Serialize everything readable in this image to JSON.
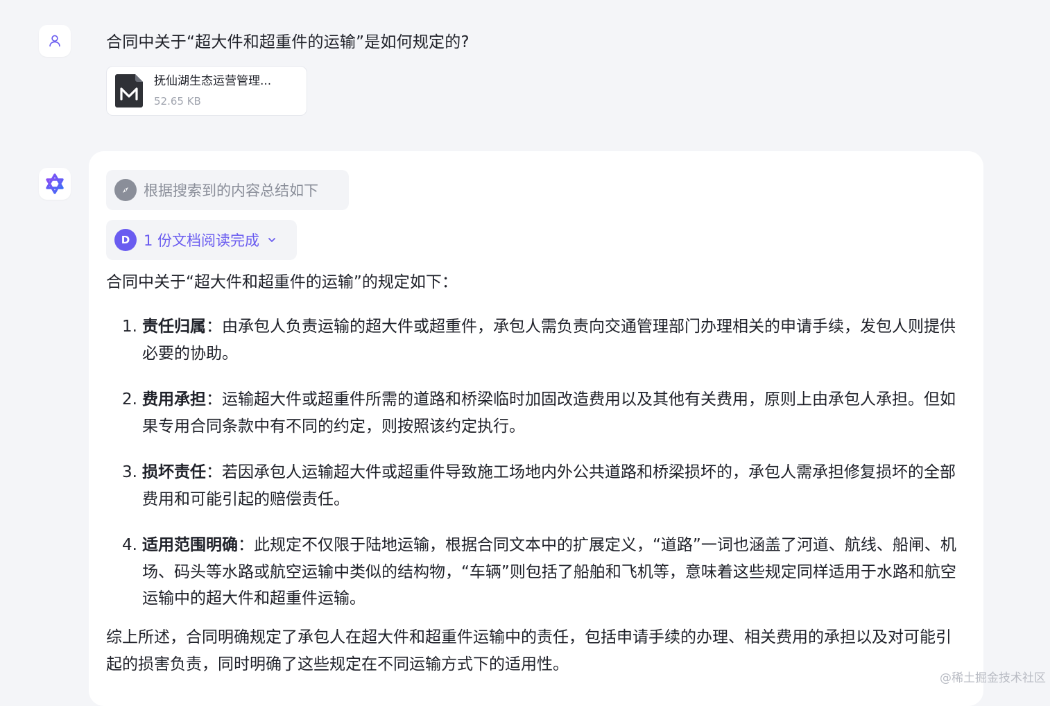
{
  "question": "合同中关于“超大件和超重件的运输”是如何规定的?",
  "attachment": {
    "name": "抚仙湖生态运营管理...",
    "size": "52.65 KB"
  },
  "answer": {
    "search_status": "根据搜索到的内容总结如下",
    "docs_badge": "D",
    "docs_status": "1 份文档阅读完成",
    "intro": "合同中关于“超大件和超重件的运输”的规定如下：",
    "items": [
      {
        "num": "1.",
        "title": "责任归属",
        "sep": "：",
        "text": "由承包人负责运输的超大件或超重件，承包人需负责向交通管理部门办理相关的申请手续，发包人则提供必要的协助。"
      },
      {
        "num": "2.",
        "title": "费用承担",
        "sep": "：",
        "text": "运输超大件或超重件所需的道路和桥梁临时加固改造费用以及其他有关费用，原则上由承包人承担。但如果专用合同条款中有不同的约定，则按照该约定执行。"
      },
      {
        "num": "3.",
        "title": "损坏责任",
        "sep": "：",
        "text": "若因承包人运输超大件或超重件导致施工场地内外公共道路和桥梁损坏的，承包人需承担修复损坏的全部费用和可能引起的赔偿责任。"
      },
      {
        "num": "4.",
        "title": "适用范围明确",
        "sep": "：",
        "text": "此规定不仅限于陆地运输，根据合同文本中的扩展定义，“道路”一词也涵盖了河道、航线、船闸、机场、码头等水路或航空运输中类似的结构物，“车辆”则包括了船舶和飞机等，意味着这些规定同样适用于水路和航空运输中的超大件和超重件运输。"
      }
    ],
    "summary": "综上所述，合同明确规定了承包人在超大件和超重件运输中的责任，包括申请手续的办理、相关费用的承担以及对可能引起的损害负责，同时明确了这些规定在不同运输方式下的适用性。"
  },
  "watermark": "@稀土掘金技术社区",
  "colors": {
    "background": "#f4f5f8",
    "accent": "#6a5cf0",
    "muted": "#8a8e99"
  }
}
